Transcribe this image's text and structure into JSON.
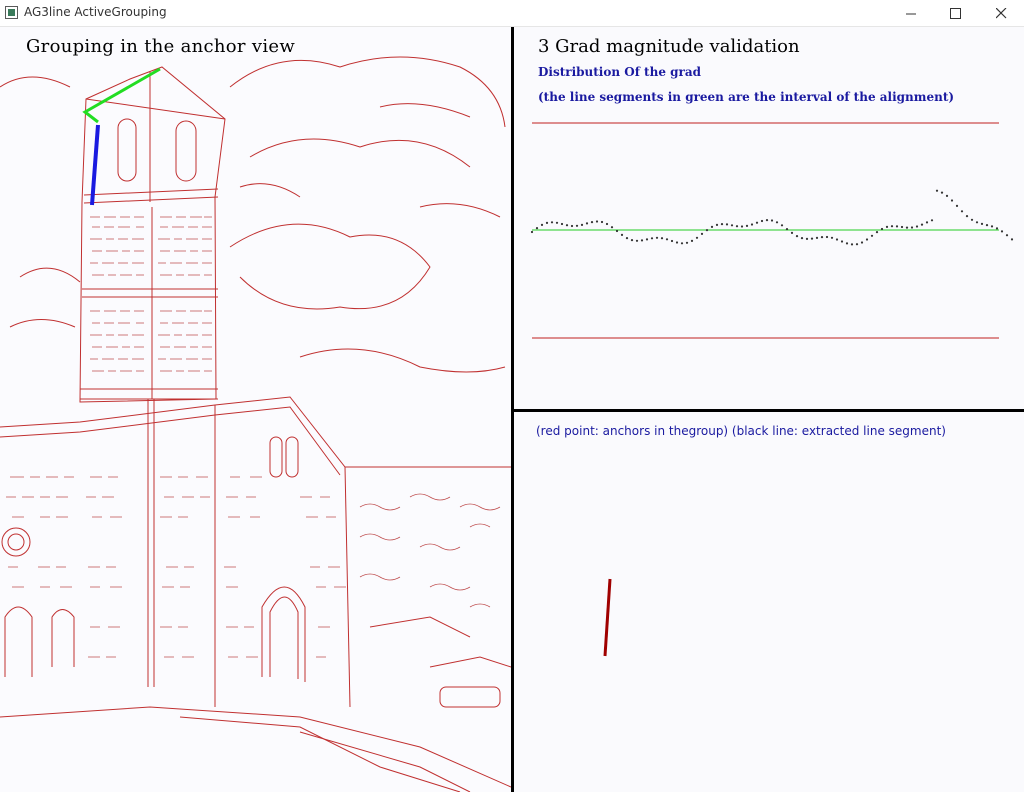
{
  "window": {
    "title": "AG3line ActiveGrouping",
    "icon": "app-window-icon",
    "controls": [
      "minimize-icon",
      "maximize-icon",
      "close-icon"
    ]
  },
  "anchor_view": {
    "title": "Grouping in the anchor view"
  },
  "grad_panel": {
    "title": "3 Grad magnitude validation",
    "subtitle1": "Distribution Of the grad",
    "subtitle2": "(the line segments in green are the interval of the alignment)",
    "colors": {
      "bound": "#c02020",
      "interval": "#22cc22",
      "dots": "#333333"
    }
  },
  "group_panel": {
    "caption": "(red point: anchors in thegroup) (black line: extracted line segment)",
    "colors": {
      "anchor": "#a00000"
    }
  }
}
